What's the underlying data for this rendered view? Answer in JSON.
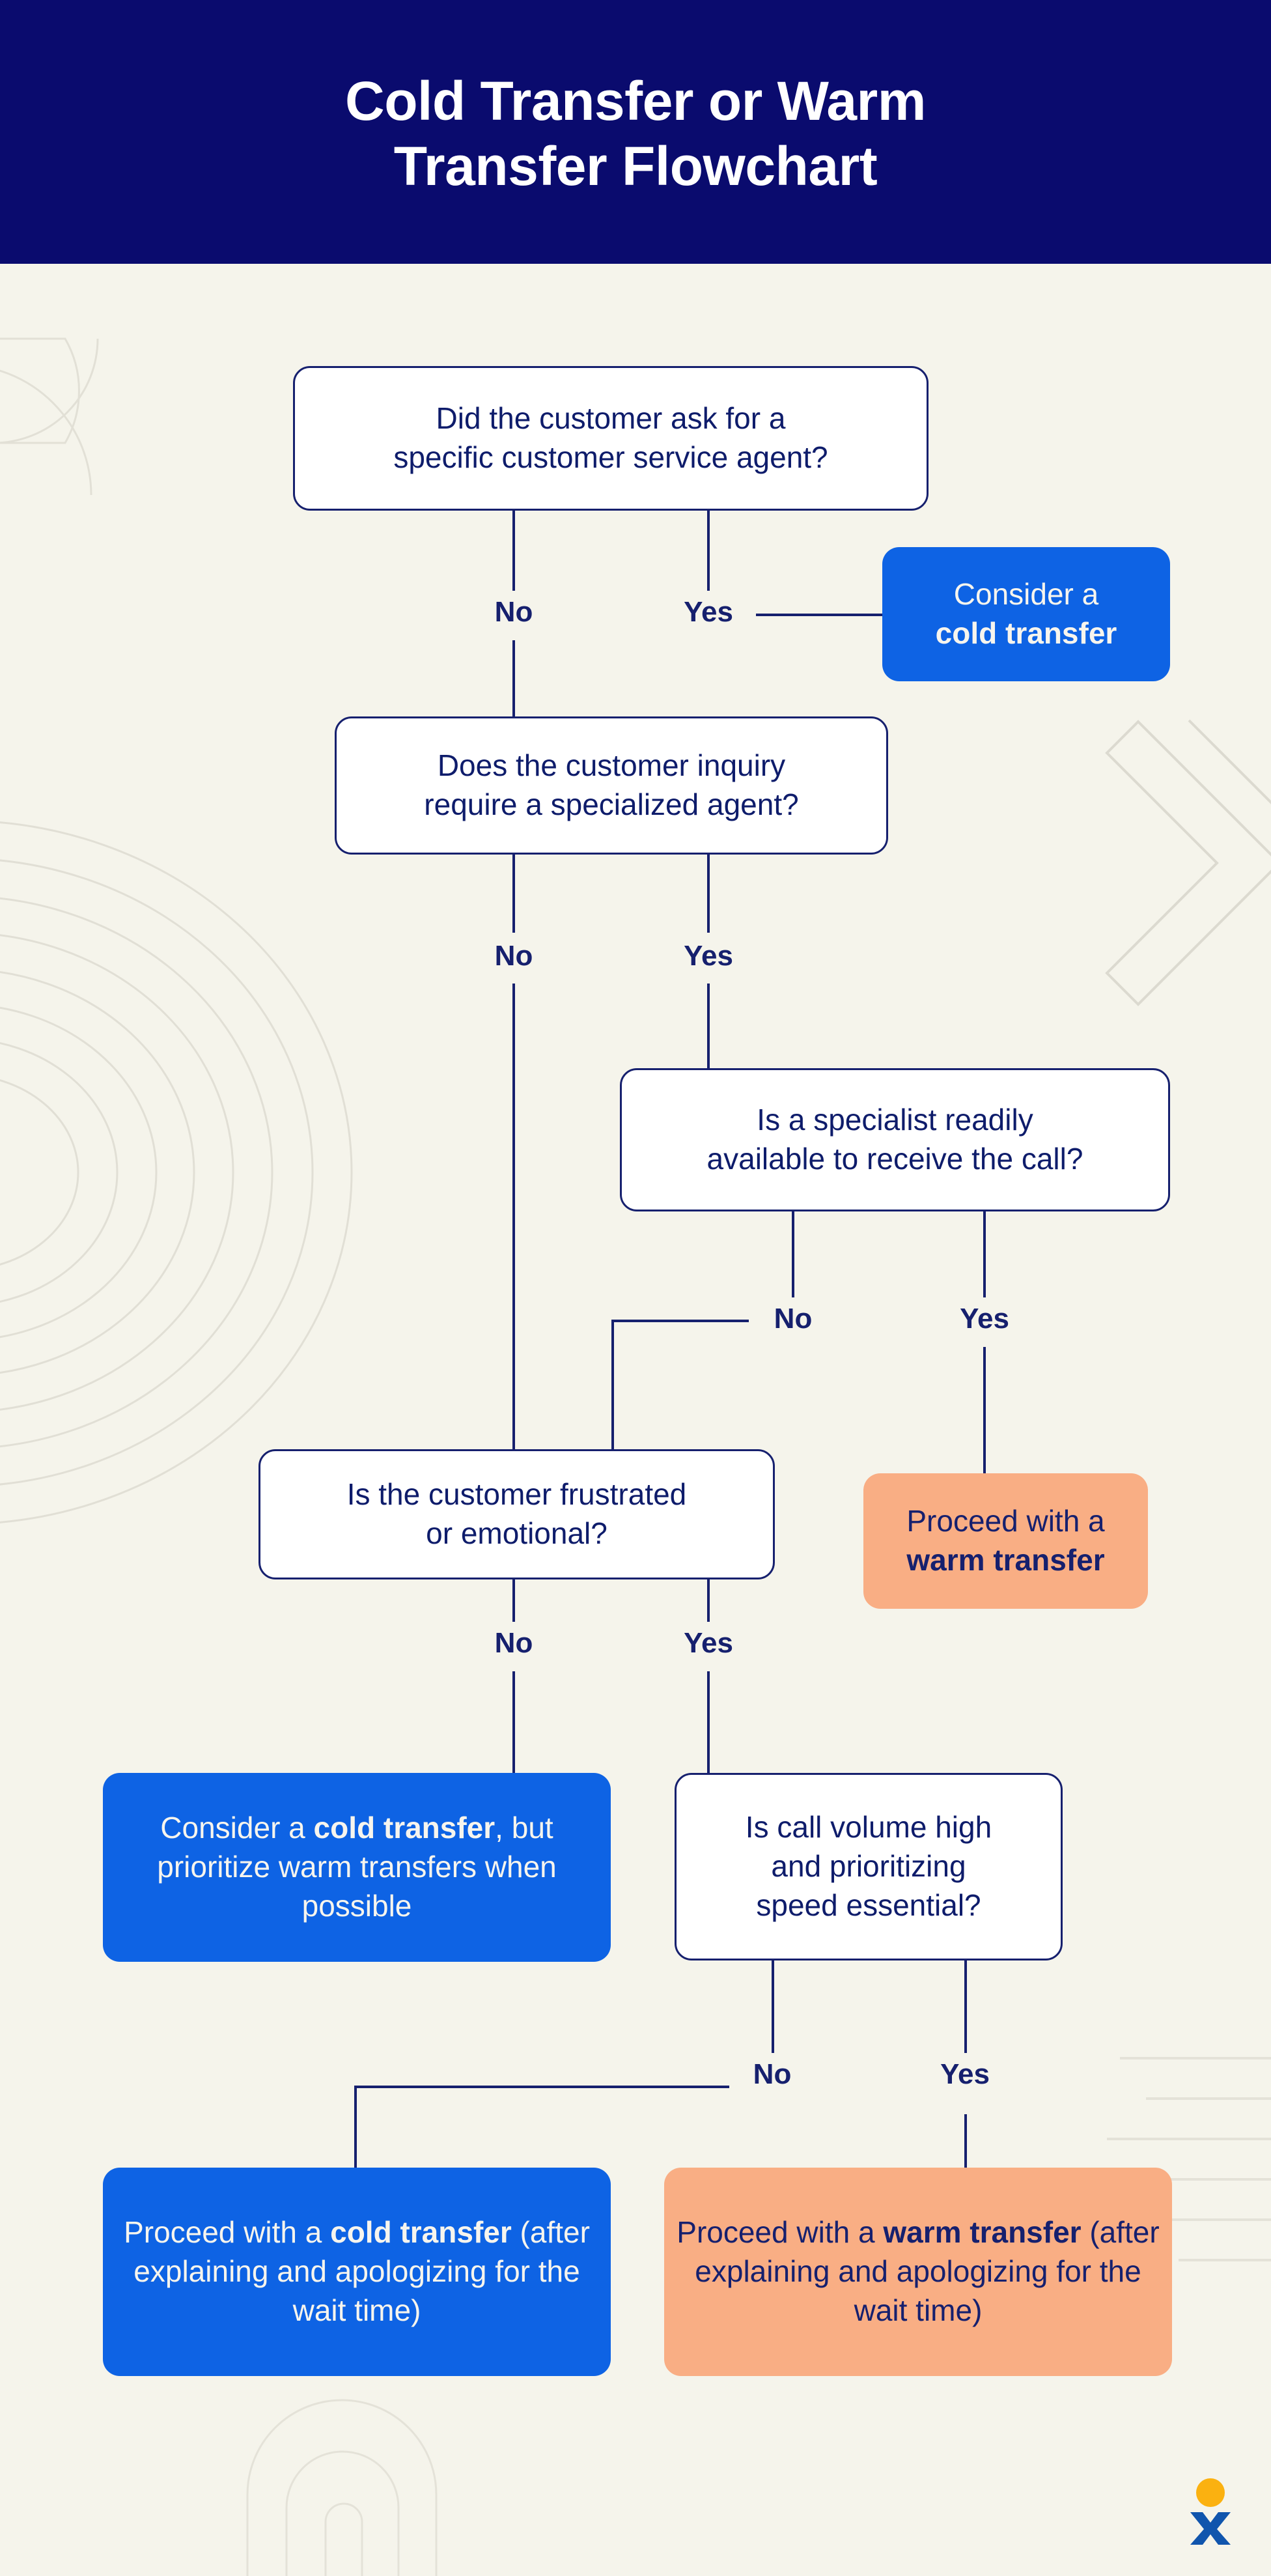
{
  "header": {
    "title_line1": "Cold Transfer or Warm",
    "title_line2": "Transfer Flowchart"
  },
  "colors": {
    "background": "#F5F4EB",
    "header_bg": "#0A0B6E",
    "navy": "#16206E",
    "cold_blue": "#0E63E4",
    "warm_orange": "#F9AE84",
    "white": "#FFFFFF",
    "logo_yellow": "#FBB110",
    "logo_blue": "#1055AD",
    "decor_line": "#DEDCD2"
  },
  "nodes": {
    "q1": {
      "id": "q1",
      "type": "decision",
      "line1": "Did the customer ask for a",
      "line2": "specific customer service agent?"
    },
    "r1": {
      "id": "r1",
      "type": "cold",
      "line1": "Consider a",
      "line2_bold": "cold transfer"
    },
    "q2": {
      "id": "q2",
      "type": "decision",
      "line1": "Does the customer inquiry",
      "line2": "require a specialized agent?"
    },
    "q3": {
      "id": "q3",
      "type": "decision",
      "line1": "Is a specialist readily",
      "line2": "available to receive the call?"
    },
    "r2": {
      "id": "r2",
      "type": "warm",
      "line1": "Proceed with a",
      "line2_bold": "warm transfer"
    },
    "q4": {
      "id": "q4",
      "type": "decision",
      "line1": "Is the customer frustrated",
      "line2": "or emotional?"
    },
    "r3": {
      "id": "r3",
      "type": "cold",
      "part1": "Consider a ",
      "part2_bold": "cold transfer",
      "part3": ", but prioritize warm transfers when possible"
    },
    "q5": {
      "id": "q5",
      "type": "decision",
      "line1": "Is call volume high",
      "line2": "and prioritizing",
      "line3": "speed essential?"
    },
    "r4": {
      "id": "r4",
      "type": "cold",
      "part1": "Proceed with a ",
      "part2_bold": "cold transfer",
      "part3": " (after explaining and apologizing for the wait time)"
    },
    "r5": {
      "id": "r5",
      "type": "warm",
      "part1": "Proceed with a ",
      "part2_bold": "warm transfer",
      "part3": " (after explaining and apologizing for the wait time)"
    }
  },
  "branch_labels": {
    "q1_no": "No",
    "q1_yes": "Yes",
    "q2_no": "No",
    "q2_yes": "Yes",
    "q3_no": "No",
    "q3_yes": "Yes",
    "q4_no": "No",
    "q4_yes": "Yes",
    "q5_no": "No",
    "q5_yes": "Yes"
  },
  "logo": {
    "name": "brand-logo",
    "shape": "circle-over-x"
  }
}
